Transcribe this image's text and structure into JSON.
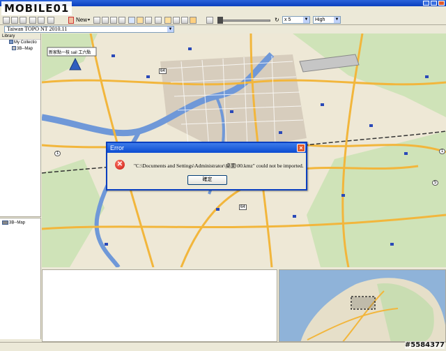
{
  "logo": "MOBILE01",
  "watermark": "#5584377",
  "toolbar": {
    "new_label": "New",
    "zoom_value": "x 5",
    "detail_value": "High"
  },
  "map_product": "Taiwan TOPO NT 2010.11",
  "library": {
    "header": "Library",
    "items": [
      "My Collectio",
      "3B--Map"
    ]
  },
  "secondary_pane": {
    "item": "3B--Map"
  },
  "map_label": "新家點一枝 sail 工六點",
  "road_badges": [
    "64",
    "1",
    "64",
    "5",
    "1"
  ],
  "dialog": {
    "title": "Error",
    "message": "\"C:\\Documents and Settings\\Administrator\\桌面\\00.kmz\" could not be imported.",
    "ok_label": "確定"
  },
  "colors": {
    "titlebar": "#0a3fbf",
    "error": "#c8140b",
    "road": "#f2b63c",
    "river": "#6f98d8"
  }
}
